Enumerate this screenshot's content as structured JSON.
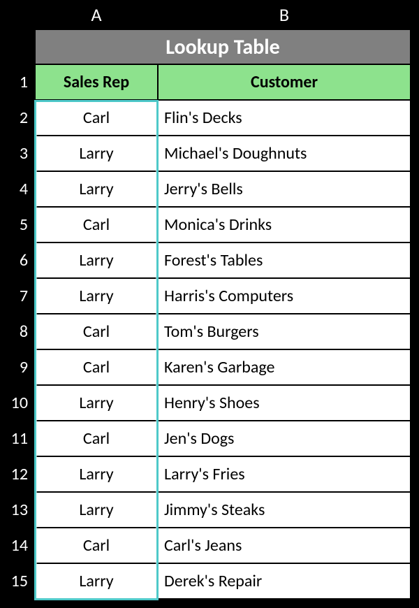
{
  "columns": {
    "a": "A",
    "b": "B"
  },
  "title": "Lookup Table",
  "headers": {
    "a": "Sales Rep",
    "b": "Customer"
  },
  "row_numbers": [
    "1",
    "2",
    "3",
    "4",
    "5",
    "6",
    "7",
    "8",
    "9",
    "10",
    "11",
    "12",
    "13",
    "14",
    "15"
  ],
  "rows": [
    {
      "a": "Carl",
      "b": "Flin's Decks"
    },
    {
      "a": "Larry",
      "b": "Michael's Doughnuts"
    },
    {
      "a": "Larry",
      "b": "Jerry's Bells"
    },
    {
      "a": "Carl",
      "b": "Monica's Drinks"
    },
    {
      "a": "Larry",
      "b": "Forest's Tables"
    },
    {
      "a": "Larry",
      "b": "Harris's Computers"
    },
    {
      "a": "Carl",
      "b": "Tom's Burgers"
    },
    {
      "a": "Carl",
      "b": "Karen's Garbage"
    },
    {
      "a": "Larry",
      "b": "Henry's Shoes"
    },
    {
      "a": "Carl",
      "b": "Jen's Dogs"
    },
    {
      "a": "Larry",
      "b": "Larry's Fries"
    },
    {
      "a": "Larry",
      "b": "Jimmy's Steaks"
    },
    {
      "a": "Carl",
      "b": "Carl's Jeans"
    },
    {
      "a": "Larry",
      "b": "Derek's Repair"
    }
  ]
}
